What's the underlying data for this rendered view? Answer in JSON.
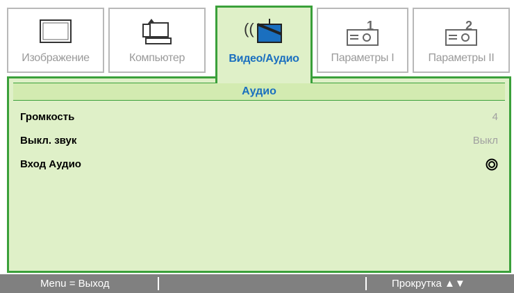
{
  "tabs": [
    {
      "label": "Изображение",
      "icon": "monitor-icon",
      "active": false
    },
    {
      "label": "Компьютер",
      "icon": "computer-icon",
      "active": false
    },
    {
      "label": "Видео/Аудио",
      "icon": "tv-audio-icon",
      "active": true
    },
    {
      "label": "Параметры I",
      "icon": "projector-1-icon",
      "active": false
    },
    {
      "label": "Параметры II",
      "icon": "projector-2-icon",
      "active": false
    }
  ],
  "section_title": "Аудио",
  "rows": [
    {
      "name": "Громкость",
      "value": "4"
    },
    {
      "name": "Выкл. звук",
      "value": "Выкл"
    },
    {
      "name": "Вход Аудио",
      "value_icon": "target-icon"
    }
  ],
  "footer": {
    "exit": "Menu = Выход",
    "scroll": "Прокрутка ▲▼"
  },
  "colors": {
    "active_border": "#3aa03a",
    "panel_bg": "#dff0c8",
    "active_text": "#1a6fbf",
    "inactive_text": "#9a9a9a",
    "footer_bg": "#808080"
  }
}
